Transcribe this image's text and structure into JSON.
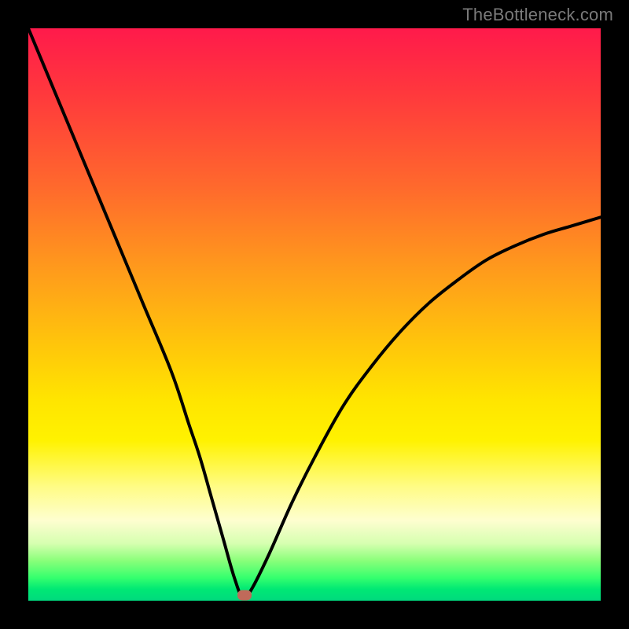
{
  "watermark": "TheBottleneck.com",
  "colors": {
    "frame": "#000000",
    "curve": "#000000",
    "marker": "#c06a5a"
  },
  "chart_data": {
    "type": "line",
    "title": "",
    "xlabel": "",
    "ylabel": "",
    "xlim": [
      0,
      100
    ],
    "ylim": [
      0,
      100
    ],
    "grid": false,
    "legend": false,
    "series": [
      {
        "name": "bottleneck-curve",
        "x": [
          0,
          5,
          10,
          15,
          20,
          25,
          28,
          30,
          32,
          34,
          36,
          37.5,
          39,
          42,
          46,
          50,
          55,
          60,
          65,
          70,
          75,
          80,
          85,
          90,
          95,
          100
        ],
        "values": [
          100,
          88,
          76,
          64,
          52,
          40,
          31,
          25,
          18,
          11,
          4,
          0.5,
          2,
          8,
          17,
          25,
          34,
          41,
          47,
          52,
          56,
          59.5,
          62,
          64,
          65.5,
          67
        ]
      }
    ],
    "marker": {
      "x": 37.8,
      "y": 0.9
    }
  }
}
